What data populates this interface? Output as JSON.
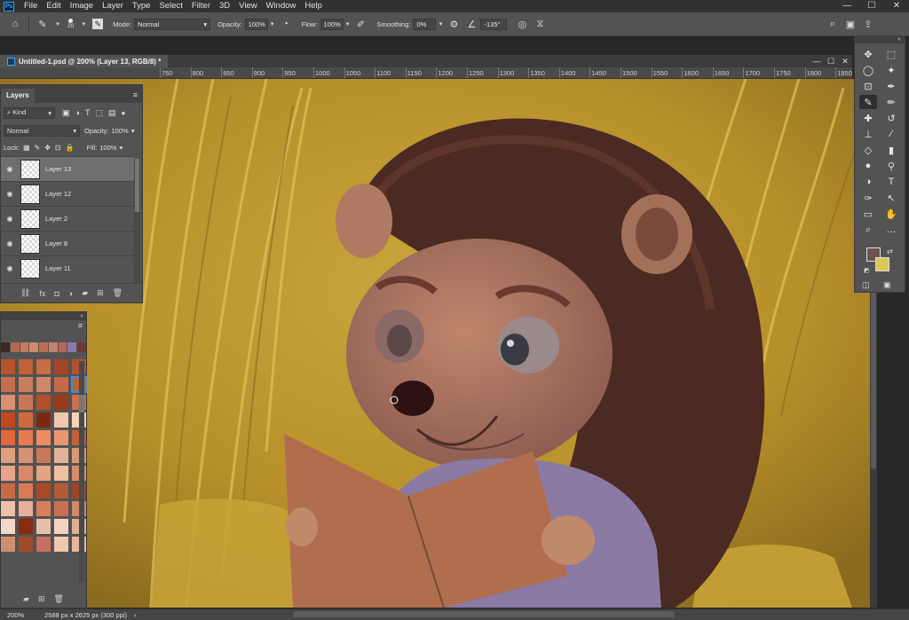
{
  "menu": [
    "File",
    "Edit",
    "Image",
    "Layer",
    "Type",
    "Select",
    "Filter",
    "3D",
    "View",
    "Window",
    "Help"
  ],
  "window_controls": [
    "—",
    "☐",
    "✕"
  ],
  "options": {
    "brush_size": "20",
    "mode_label": "Mode:",
    "mode_value": "Normal",
    "opacity_label": "Opacity:",
    "opacity_value": "100%",
    "flow_label": "Flow:",
    "flow_value": "100%",
    "smoothing_label": "Smoothing:",
    "smoothing_value": "0%",
    "angle_value": "-135°"
  },
  "document": {
    "tab_title": "Untitled-1.psd @ 200% (Layer 13, RGB/8) *",
    "ruler_ticks": [
      "750",
      "800",
      "850",
      "900",
      "950",
      "1000",
      "1050",
      "1100",
      "1150",
      "1200",
      "1250",
      "1300",
      "1350",
      "1400",
      "1450",
      "1500",
      "1550",
      "1600",
      "1650",
      "1700",
      "1750",
      "1800",
      "1850"
    ]
  },
  "layers_panel": {
    "tab_label": "Layers",
    "filter_label": "Kind",
    "blend_mode": "Normal",
    "opacity_label": "Opacity:",
    "opacity_value": "100%",
    "lock_label": "Lock:",
    "fill_label": "Fill:",
    "fill_value": "100%",
    "layers": [
      {
        "name": "Layer 13",
        "selected": true
      },
      {
        "name": "Layer 12",
        "selected": false
      },
      {
        "name": "Layer 2",
        "selected": false
      },
      {
        "name": "Layer 8",
        "selected": false
      },
      {
        "name": "Layer 11",
        "selected": false
      }
    ]
  },
  "status": {
    "zoom": "200%",
    "doc_info": "2588 px x 2625 px (300 ppi)"
  },
  "colors": {
    "foreground": "#6e5450",
    "background": "#d8c85a",
    "recent_swatches": [
      "#3a2a22",
      "#b06a52",
      "#c87a5e",
      "#d08a6a",
      "#bd6f55",
      "#c98066",
      "#b5665c",
      "#8a7aa8",
      "#6a3a32"
    ],
    "swatch_grid": [
      "#b5542a",
      "#bf6236",
      "#c86e42",
      "#a34628",
      "#b05234",
      "#c46e4e",
      "#c97e5e",
      "#d0886a",
      "#c46a48",
      "#b9642e",
      "#d89070",
      "#c97656",
      "#b2502a",
      "#9c3a1a",
      "#c87050",
      "#c04820",
      "#d06a3c",
      "#7a2a10",
      "#f0c8b0",
      "#f2d2b8",
      "#e0683c",
      "#e87a50",
      "#f08c60",
      "#e89870",
      "#c0603c",
      "#e0a080",
      "#d89074",
      "#c87858",
      "#e0b49a",
      "#d89878",
      "#e8a48a",
      "#d88a68",
      "#e4a480",
      "#f0c0a0",
      "#d88c66",
      "#c86a44",
      "#d87a52",
      "#a84a28",
      "#b05a36",
      "#9e4426",
      "#f0c0a8",
      "#e8b098",
      "#d8805c",
      "#c87050",
      "#d0886a",
      "#f2d8c8",
      "#8a2a10",
      "#e8c0a8",
      "#f4d4c0",
      "#e0b090",
      "#d09070",
      "#a04a2c",
      "#c87060",
      "#f0c8b0",
      "#e8b89c"
    ]
  }
}
